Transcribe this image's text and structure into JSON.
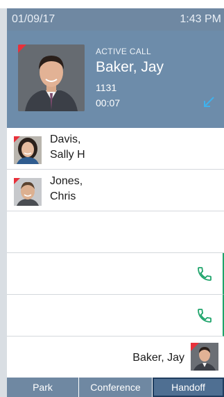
{
  "status": {
    "date": "01/09/17",
    "time": "1:43 PM"
  },
  "active_call": {
    "label": "ACTIVE CALL",
    "name": "Baker, Jay",
    "extension": "1131",
    "duration": "00:07"
  },
  "contacts": [
    {
      "name_line1": "Davis,",
      "name_line2": "Sally H"
    },
    {
      "name_line1": "Jones,",
      "name_line2": "Chris"
    }
  ],
  "self": {
    "name": "Baker, Jay"
  },
  "softkeys": [
    "Park",
    "Conference",
    "Handoff"
  ],
  "colors": {
    "accent": "#6d8caa",
    "presence_green": "#1fa46b",
    "flag_red": "#e8303a"
  }
}
